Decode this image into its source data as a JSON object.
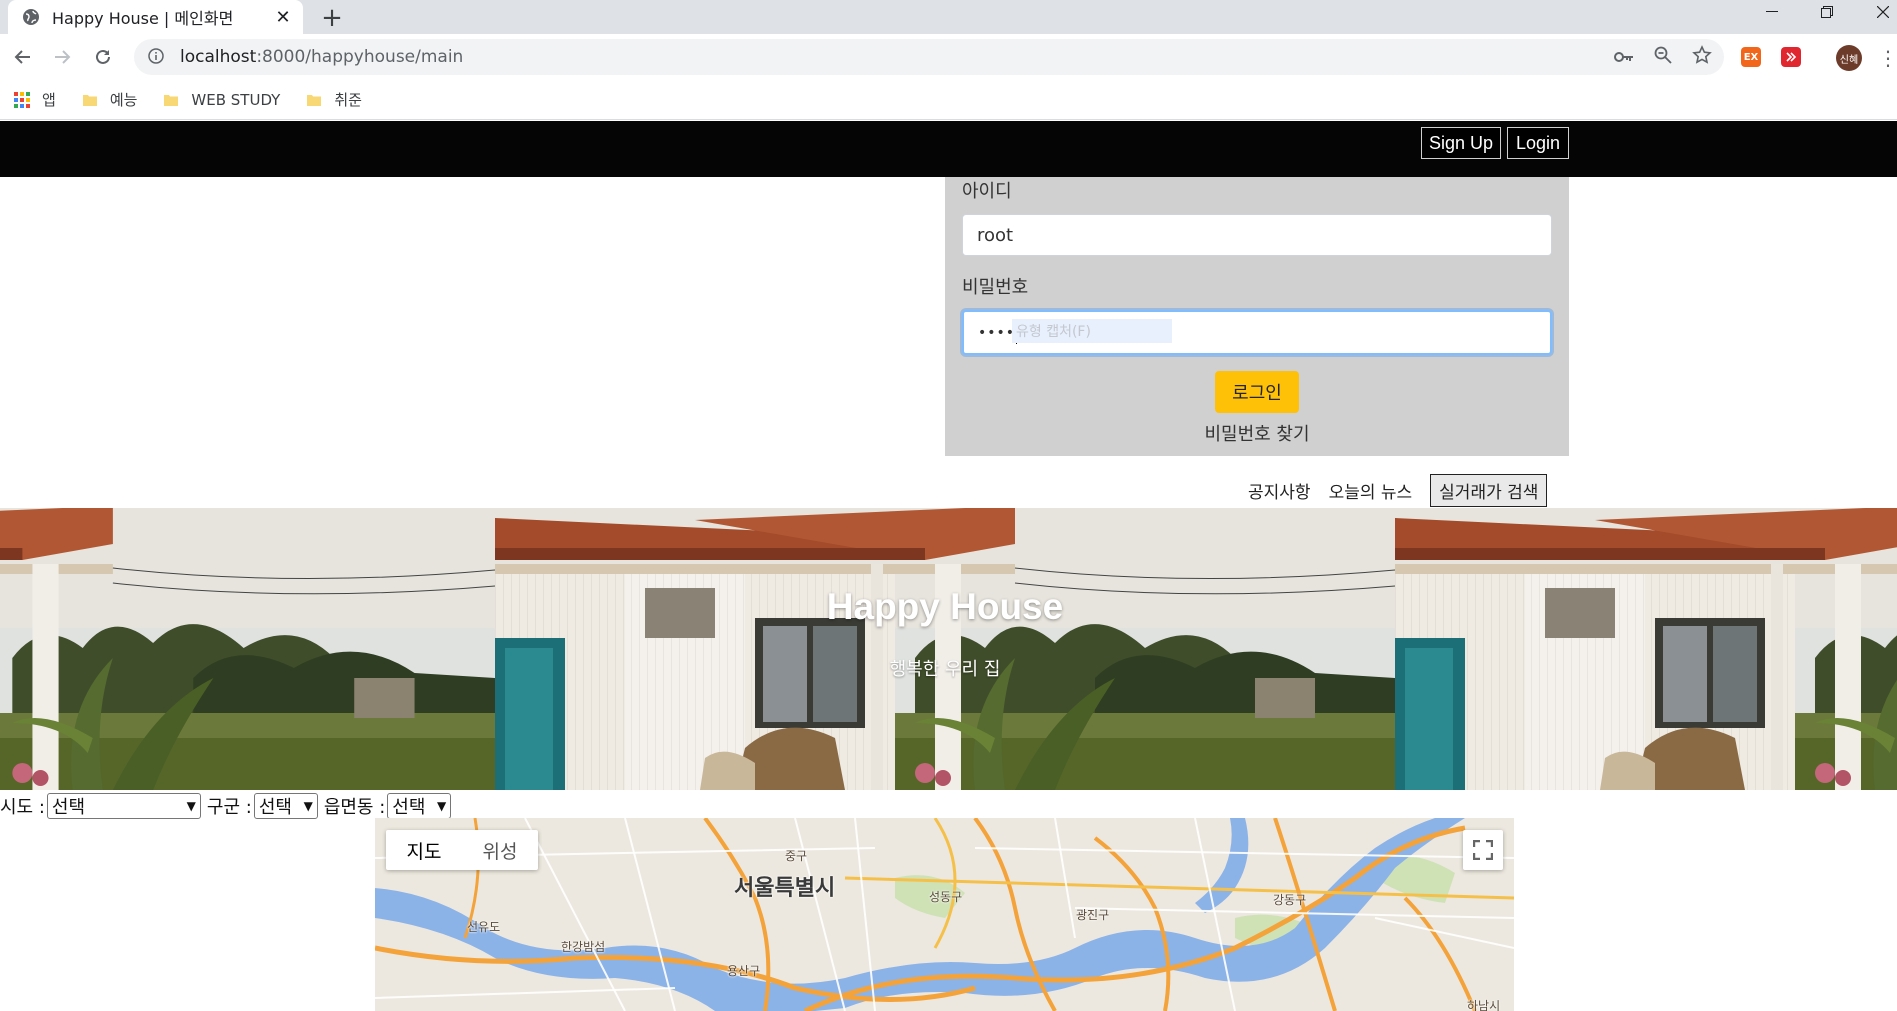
{
  "browser": {
    "tab_title": "Happy House | 메인화면",
    "url_host": "localhost",
    "url_rest": ":8000/happyhouse/main",
    "bookmarks": [
      "앱",
      "예능",
      "WEB STUDY",
      "취준"
    ],
    "ext1": "EX",
    "avatar": "신혜"
  },
  "nav": {
    "signup": "Sign Up",
    "login": "Login"
  },
  "login_panel": {
    "id_label": "아이디",
    "id_value": "root",
    "pw_label": "비밀번호",
    "pw_value": "••••",
    "autofill_hint": "유형 캡처(F)",
    "submit": "로그인",
    "find_pw": "비밀번호 찾기"
  },
  "subnav": {
    "notice": "공지사항",
    "news": "오늘의 뉴스",
    "search": "실거래가 검색"
  },
  "hero": {
    "title": "Happy House",
    "subtitle": "행복한 우리 집"
  },
  "filters": {
    "sido_label": "시도 :",
    "sido_value": "선택",
    "gugun_label": "구군 :",
    "gugun_value": "선택",
    "dong_label": "읍면동 :",
    "dong_value": "선택"
  },
  "map": {
    "type_map": "지도",
    "type_satellite": "위성",
    "labels": {
      "seoul": "서울특별시",
      "junggu": "중구",
      "seongdong": "성동구",
      "gwangjin": "광진구",
      "gangdong": "강동구",
      "seonyudo": "선유도",
      "hangang": "한강밤섬",
      "yongsan": "용산구",
      "hanam": "하남시"
    }
  }
}
